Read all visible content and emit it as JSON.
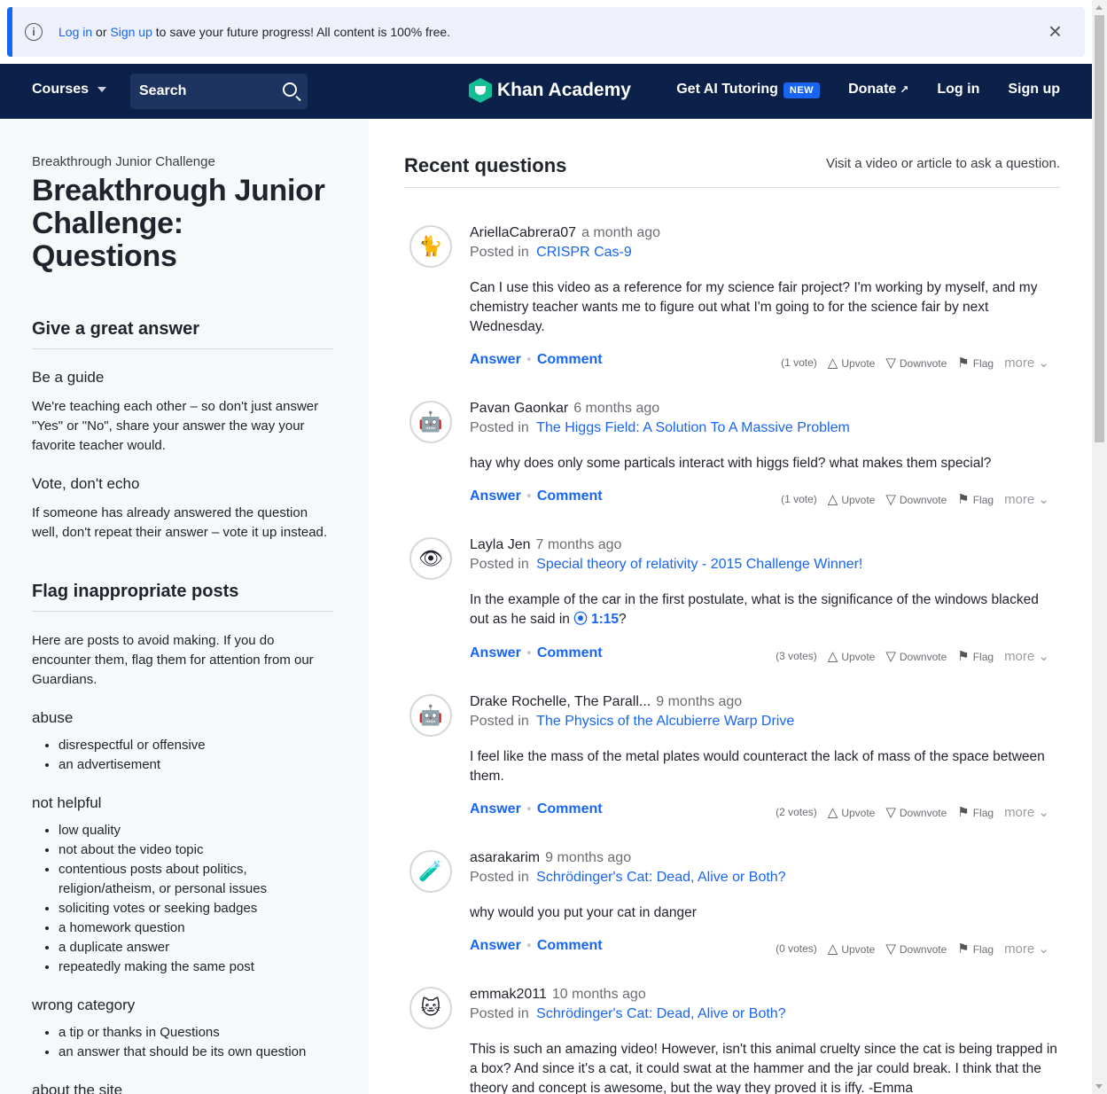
{
  "banner": {
    "login": "Log in",
    "or": " or ",
    "signup": "Sign up",
    "rest": " to save your future progress! All content is 100% free.",
    "close": "×"
  },
  "nav": {
    "courses": "Courses",
    "search_label": "Search",
    "logo_text": "Khan Academy",
    "ai": "Get AI Tutoring",
    "ai_badge": "NEW",
    "donate": "Donate",
    "login": "Log in",
    "signup": "Sign up"
  },
  "sidebar": {
    "crumb": "Breakthrough Junior Challenge",
    "title": "Breakthrough Junior Challenge: Questions",
    "give_heading": "Give a great answer",
    "guide_heading": "Be a guide",
    "guide_text": "We're teaching each other – so don't just answer \"Yes\" or \"No\", share your answer the way your favorite teacher would.",
    "vote_heading": "Vote, don't echo",
    "vote_text": "If someone has already answered the question well, don't repeat their answer – vote it up instead.",
    "flag_heading": "Flag inappropriate posts",
    "flag_text": "Here are posts to avoid making. If you do encounter them, flag them for attention from our Guardians.",
    "abuse_heading": "abuse",
    "abuse_items": [
      "disrespectful or offensive",
      "an advertisement"
    ],
    "nothelp_heading": "not helpful",
    "nothelp_items": [
      "low quality",
      "not about the video topic",
      "contentious posts about politics, religion/atheism, or personal issues",
      "soliciting votes or seeking badges",
      "a homework question",
      "a duplicate answer",
      "repeatedly making the same post"
    ],
    "wrong_heading": "wrong category",
    "wrong_items": [
      "a tip or thanks in Questions",
      "an answer that should be its own question"
    ],
    "about_heading": "about the site"
  },
  "main": {
    "title": "Recent questions",
    "hint": "Visit a video or article to ask a question.",
    "posted_in": "Posted in",
    "answer": "Answer",
    "comment": "Comment",
    "upvote": "Upvote",
    "downvote": "Downvote",
    "flag": "Flag",
    "more": "more",
    "questions": [
      {
        "author": "AriellaCabrera07",
        "time": "a month ago",
        "topic": "CRISPR Cas-9",
        "body": "Can I use this video as a reference for my science fair project? I'm working by myself, and my chemistry teacher wants me to figure out what I'm going to for the science fair by next Wednesday.",
        "votes": "(1 vote)",
        "avatar": "🐈"
      },
      {
        "author": "Pavan Gaonkar",
        "time": "6 months ago",
        "topic": "The Higgs Field: A Solution To A Massive Problem",
        "body": "hay why does only some particals interact with higgs field? what makes them special?",
        "votes": "(1 vote)",
        "avatar": "🤖"
      },
      {
        "author": "Layla Jen",
        "time": "7 months ago",
        "topic": "Special theory of relativity - 2015 Challenge Winner!",
        "body_pre": "In the example of the car in the first postulate, what is the significance of the windows blacked out as he said in ",
        "timestamp": "⦿ 1:15",
        "body_post": "?",
        "votes": "(3 votes)",
        "avatar": "👁"
      },
      {
        "author": "Drake Rochelle, The Parall...",
        "time": "9 months ago",
        "topic": "The Physics of the Alcubierre Warp Drive",
        "body": "I feel like the mass of the metal plates would counteract the lack of mass of the space between them.",
        "votes": "(2 votes)",
        "avatar": "🤖"
      },
      {
        "author": "asarakarim",
        "time": "9 months ago",
        "topic": "Schrödinger's Cat: Dead, Alive or Both?",
        "body": "why would you put your cat in danger",
        "votes": "(0 votes)",
        "avatar": "🧪"
      },
      {
        "author": "emmak2011",
        "time": "10 months ago",
        "topic": "Schrödinger's Cat: Dead, Alive or Both?",
        "body": "This is such an amazing video! However, isn't this animal cruelty since the cat is being trapped in a box? And since it's a cat, it could swat at the hammer and the jar could break. I think that the theory and concept is awesome, but the way they proved it is iffy. -Emma",
        "votes": "",
        "avatar": "🐱"
      }
    ]
  },
  "colors": {
    "brand": "#0b2149",
    "link": "#1865f2",
    "accent_green": "#14bf96"
  }
}
